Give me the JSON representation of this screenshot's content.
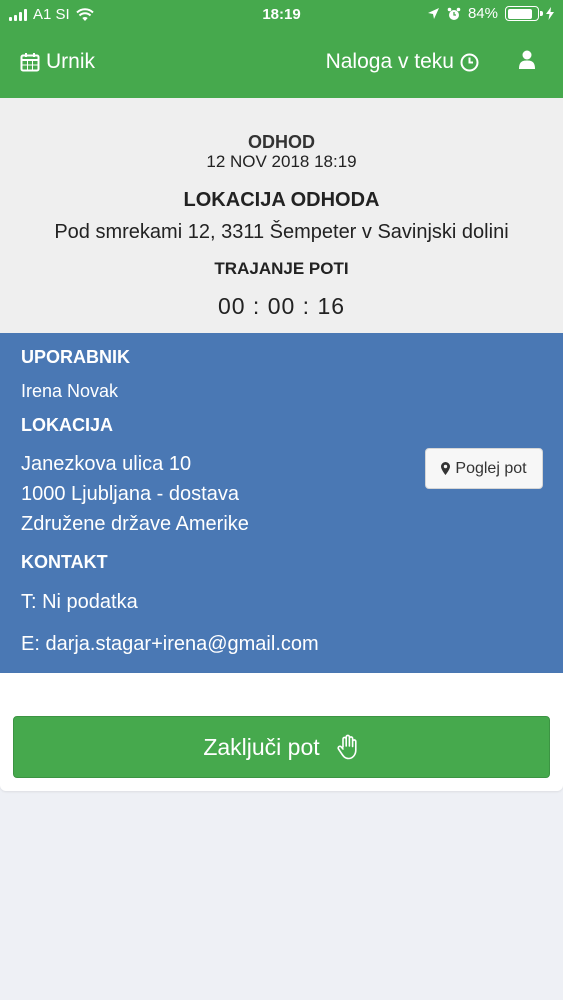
{
  "status_bar": {
    "carrier": "A1 SI",
    "time": "18:19",
    "battery": "84%",
    "battery_level": 0.84
  },
  "nav": {
    "schedule_label": "Urnik",
    "tasks_label": "Naloga v teku"
  },
  "departure": {
    "heading": "ODHOD",
    "date": "12 NOV 2018 18:19",
    "location_heading": "LOKACIJA ODHODA",
    "location_address": "Pod smrekami 12, 3311 Šempeter v Savinjski dolini",
    "duration_heading": "TRAJANJE POTI",
    "duration_value": "00 : 00 : 16"
  },
  "details": {
    "user_heading": "UPORABNIK",
    "user_name": "Irena Novak",
    "location_heading": "LOKACIJA",
    "address_line1": "Janezkova ulica 10",
    "address_line2": "1000 Ljubljana - dostava",
    "address_line3": "Združene države Amerike",
    "view_route_label": "Poglej pot",
    "contact_heading": "KONTAKT",
    "phone": "T: Ni podatka",
    "email": "E: darja.stagar+irena@gmail.com"
  },
  "actions": {
    "finish_trip_label": "Zaključi pot"
  },
  "colors": {
    "primary_green": "#46a94d",
    "info_blue": "#4a78b4"
  }
}
